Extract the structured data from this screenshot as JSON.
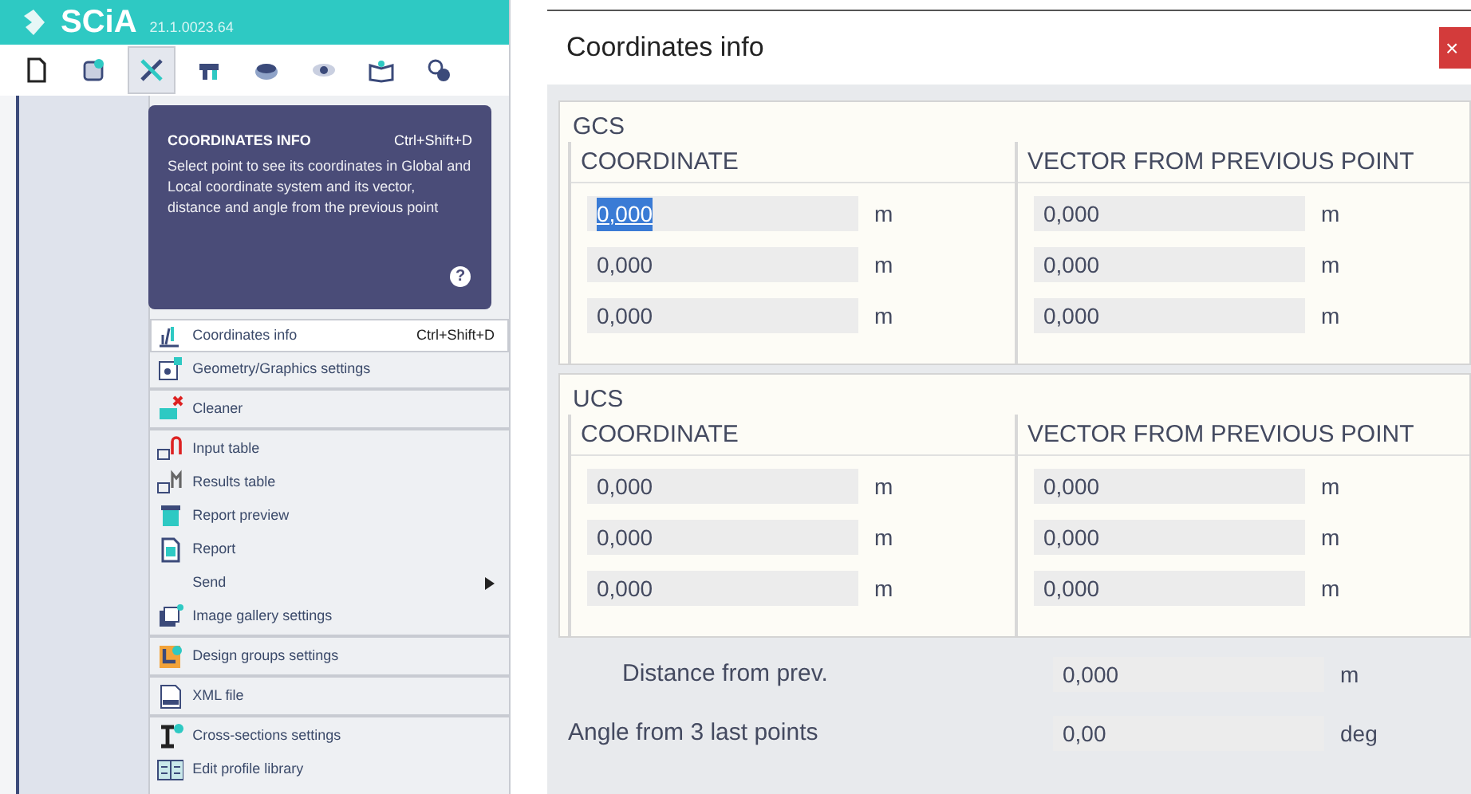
{
  "app": {
    "logo": "SCiA",
    "version": "21.1.0023.64"
  },
  "toolbar": [
    {
      "selected": false
    },
    {
      "selected": false
    },
    {
      "selected": true
    },
    {
      "selected": false
    },
    {
      "selected": false
    },
    {
      "selected": false
    },
    {
      "selected": false
    },
    {
      "selected": false
    }
  ],
  "tooltip": {
    "title": "COORDINATES INFO",
    "shortcut": "Ctrl+Shift+D",
    "text": "Select point to see its coordinates in Global and Local coordinate system and its vector, distance and angle from the previous point",
    "help": "?"
  },
  "menu": [
    [
      {
        "label": "Coordinates info",
        "shortcut": "Ctrl+Shift+D",
        "selected": true,
        "submenu": false
      },
      {
        "label": "Geometry/Graphics settings",
        "selected": false,
        "submenu": false
      }
    ],
    [
      {
        "label": "Cleaner",
        "selected": false,
        "submenu": false
      }
    ],
    [
      {
        "label": "Input table",
        "selected": false,
        "submenu": false
      },
      {
        "label": "Results table",
        "selected": false,
        "submenu": false
      },
      {
        "label": "Report preview",
        "selected": false,
        "submenu": false
      },
      {
        "label": "Report",
        "selected": false,
        "submenu": false
      },
      {
        "label": "Send",
        "selected": false,
        "submenu": true
      },
      {
        "label": "Image gallery settings",
        "selected": false,
        "submenu": false
      }
    ],
    [
      {
        "label": "Design groups settings",
        "selected": false,
        "submenu": false
      }
    ],
    [
      {
        "label": "XML file",
        "selected": false,
        "submenu": false
      }
    ],
    [
      {
        "label": "Cross-sections settings",
        "selected": false,
        "submenu": false
      },
      {
        "label": "Edit profile library",
        "selected": false,
        "submenu": false
      }
    ]
  ],
  "dialog": {
    "title": "Coordinates info",
    "close": "×",
    "sections": [
      {
        "title": "GCS",
        "columns": [
          "COORDINATE",
          "VECTOR FROM PREVIOUS POINT"
        ],
        "rows": [
          {
            "coordinate": "0,000",
            "coordinate_selected": true,
            "unit": "m",
            "vector": "0,000",
            "vector_unit": "m"
          },
          {
            "coordinate": "0,000",
            "coordinate_selected": false,
            "unit": "m",
            "vector": "0,000",
            "vector_unit": "m"
          },
          {
            "coordinate": "0,000",
            "coordinate_selected": false,
            "unit": "m",
            "vector": "0,000",
            "vector_unit": "m"
          }
        ]
      },
      {
        "title": "UCS",
        "columns": [
          "COORDINATE",
          "VECTOR FROM PREVIOUS POINT"
        ],
        "rows": [
          {
            "coordinate": "0,000",
            "coordinate_selected": false,
            "unit": "m",
            "vector": "0,000",
            "vector_unit": "m"
          },
          {
            "coordinate": "0,000",
            "coordinate_selected": false,
            "unit": "m",
            "vector": "0,000",
            "vector_unit": "m"
          },
          {
            "coordinate": "0,000",
            "coordinate_selected": false,
            "unit": "m",
            "vector": "0,000",
            "vector_unit": "m"
          }
        ]
      }
    ],
    "results": [
      {
        "label": "Distance from prev.",
        "value": "0,000",
        "unit": "m"
      },
      {
        "label": "Angle from 3 last points",
        "value": "0,00",
        "unit": "deg"
      }
    ]
  }
}
